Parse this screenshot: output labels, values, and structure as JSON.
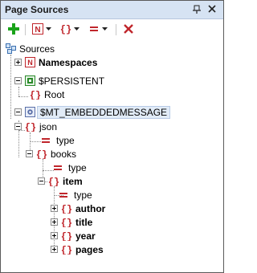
{
  "panel": {
    "title": "Page Sources"
  },
  "toolbar": {
    "add_icon": "add-plus-icon",
    "namespace_icon": "namespace-icon",
    "json_object_icon": "json-object-icon",
    "json_property_icon": "json-property-icon",
    "delete_icon": "delete-x-icon"
  },
  "tree": {
    "root": "Sources",
    "namespaces": "Namespaces",
    "persistent": "$PERSISTENT",
    "persistent_root": "Root",
    "embedded": "$MT_EMBEDDEDMESSAGE",
    "json": "json",
    "json_type": "type",
    "books": "books",
    "books_type": "type",
    "item": "item",
    "item_type": "type",
    "author": "author",
    "title": "title",
    "year": "year",
    "pages": "pages"
  },
  "colors": {
    "accent_red": "#c0262c",
    "add_green": "#1aa31a",
    "title_bg": "#d6e3f3"
  }
}
